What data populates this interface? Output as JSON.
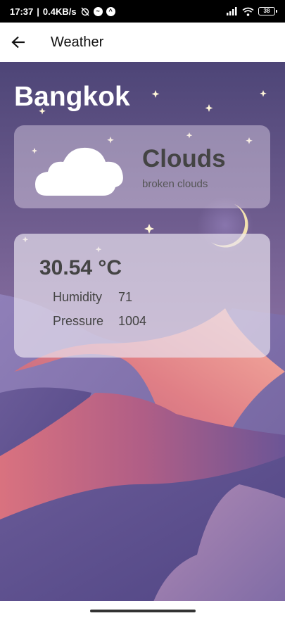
{
  "status": {
    "time": "17:37",
    "speed": "0.4KB/s",
    "battery": "38"
  },
  "appbar": {
    "title": "Weather"
  },
  "weather": {
    "city": "Bangkok",
    "main": "Clouds",
    "description": "broken clouds",
    "temperature": "30.54 °C",
    "humidity_label": "Humidity",
    "humidity_value": "71",
    "pressure_label": "Pressure",
    "pressure_value": "1004"
  },
  "colors": {
    "sky_top": "#4e4679",
    "sky_bottom": "#a07aa8",
    "dune_pink": "#d97a86",
    "dune_purple": "#5d4f8a"
  }
}
